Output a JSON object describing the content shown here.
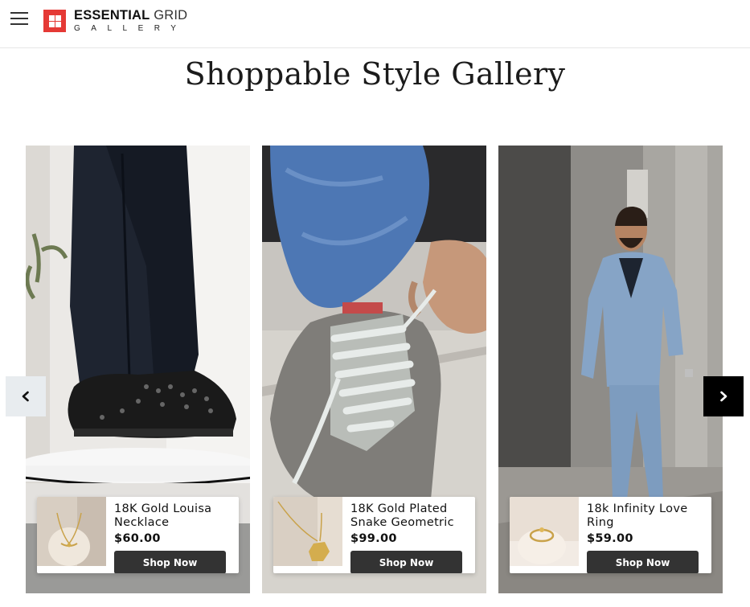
{
  "header": {
    "logo_primary": "ESSENTIAL",
    "logo_secondary": " GRID",
    "logo_tagline": "GALLERY"
  },
  "page": {
    "title": "Shoppable Style Gallery"
  },
  "colors": {
    "accent": "#e53935",
    "button": "#333333",
    "next_arrow_bg": "#000000",
    "prev_arrow_bg": "#e8ecef"
  },
  "carousel": {
    "prev_icon": "chevron-left-icon",
    "next_icon": "chevron-right-icon",
    "cards": [
      {
        "product_name": "18K Gold Louisa Necklace",
        "price": "$60.00",
        "button_label": "Shop Now"
      },
      {
        "product_name": "18K Gold Plated Snake Geometric",
        "price": "$99.00",
        "button_label": "Shop Now"
      },
      {
        "product_name": "18k Infinity Love Ring",
        "price": "$59.00",
        "button_label": "Shop Now"
      }
    ]
  }
}
